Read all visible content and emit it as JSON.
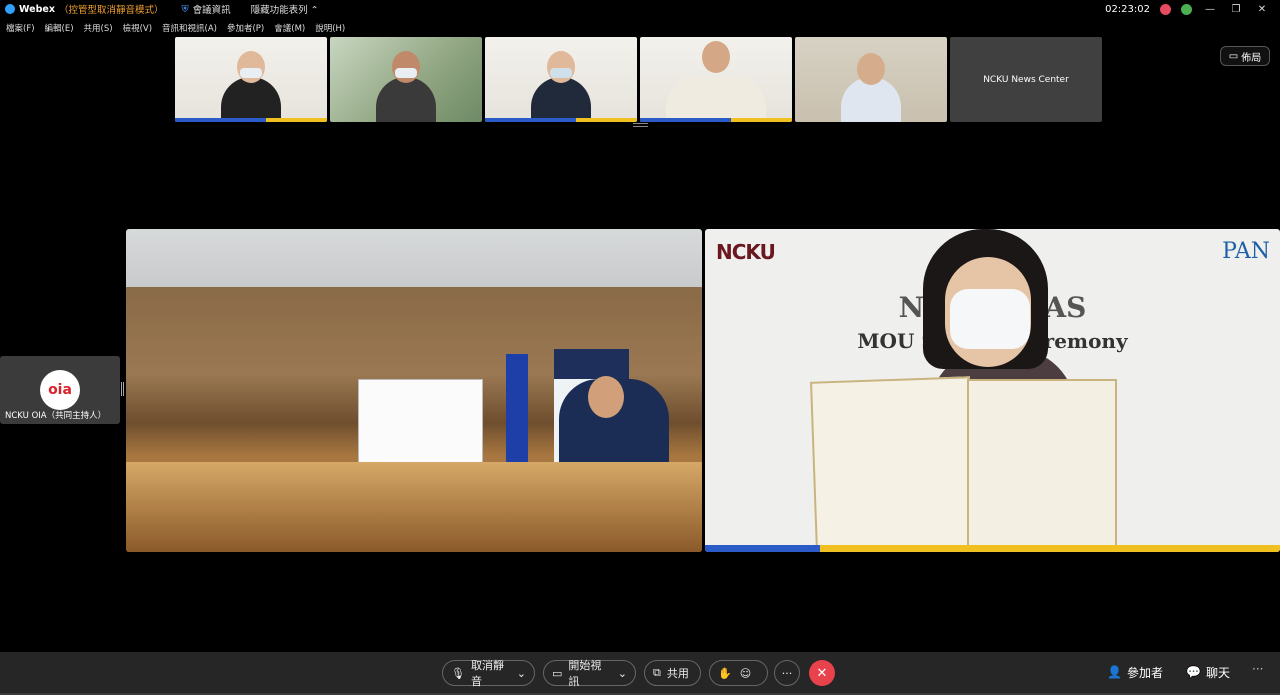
{
  "titlebar": {
    "app_name": "Webex",
    "mode": "（控管型取消靜音模式）",
    "meeting_info": "會議資訊",
    "hide_toolbar": "隱藏功能表列",
    "clock": "02:23:02"
  },
  "menu": [
    "檔案(F)",
    "編輯(E)",
    "共用(S)",
    "檢視(V)",
    "音訊和視訊(A)",
    "參加者(P)",
    "會議(M)",
    "說明(H)"
  ],
  "thumbnails": [
    {
      "label": ""
    },
    {
      "label": ""
    },
    {
      "label": ""
    },
    {
      "label": ""
    },
    {
      "label": ""
    },
    {
      "label": "NCKU News Center"
    }
  ],
  "layout_button": "佈局",
  "stage": {
    "right_logo_left": "NCKU",
    "right_logo_right": "PAN",
    "right_title": "NCKU - PAS",
    "right_subtitle": "MOU Signing Ceremony"
  },
  "side_tile": {
    "logo": "oia",
    "name": "NCKU OIA（共同主持人）"
  },
  "controls": {
    "unmute": "取消靜音",
    "start_video": "開始視訊",
    "share": "共用",
    "more": "···",
    "participants": "參加者",
    "chat": "聊天"
  },
  "colors": {
    "end_call": "#e8424c",
    "mode_text": "#f0a030",
    "background": "#000000"
  }
}
